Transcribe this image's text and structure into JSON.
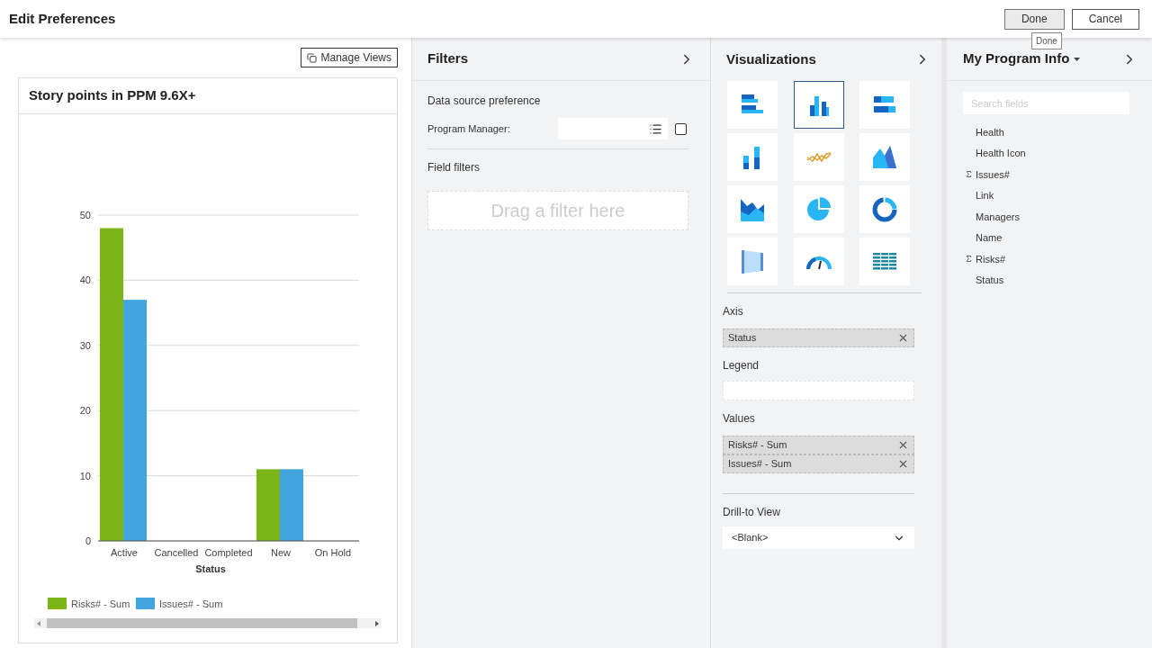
{
  "header": {
    "title": "Edit Preferences",
    "buttons": [
      {
        "label": "Done",
        "kind": "primary"
      },
      {
        "label": "Cancel",
        "kind": "secondary"
      }
    ],
    "tooltip": "Done"
  },
  "canvas": {
    "manage_views": "Manage Views",
    "card_title": "Story points in PPM 9.6X+",
    "chart_data": {
      "type": "bar",
      "xlabel": "Status",
      "categories": [
        "Active",
        "Cancelled",
        "Completed",
        "New",
        "On Hold"
      ],
      "series": [
        {
          "name": "Risks# - Sum",
          "color": "#7cb518",
          "values": [
            48,
            0,
            0,
            11,
            0
          ]
        },
        {
          "name": "Issues# - Sum",
          "color": "#42a5e0",
          "values": [
            37,
            0,
            0,
            11,
            0
          ]
        }
      ],
      "ylim": [
        0,
        50
      ],
      "yticks": [
        0,
        10,
        20,
        30,
        40,
        50
      ],
      "grid": true,
      "legend": true
    }
  },
  "filters": {
    "title": "Filters",
    "data_source": "Data source preference",
    "program_manager_label": "Program Manager:",
    "program_manager_checked": false,
    "field_filters": "Field filters",
    "drop_hint": "Drag a filter here"
  },
  "visualizations": {
    "title": "Visualizations",
    "types": [
      {
        "kind": "bar-h",
        "selected": false
      },
      {
        "kind": "column",
        "selected": true
      },
      {
        "kind": "stacked-bar-h",
        "selected": false
      },
      {
        "kind": "stacked-column",
        "selected": false
      },
      {
        "kind": "line",
        "selected": false
      },
      {
        "kind": "area",
        "selected": false
      },
      {
        "kind": "stacked-area",
        "selected": false
      },
      {
        "kind": "pie",
        "selected": false
      },
      {
        "kind": "donut",
        "selected": false
      },
      {
        "kind": "funnel",
        "selected": false
      },
      {
        "kind": "gauge",
        "selected": false
      },
      {
        "kind": "table",
        "selected": false
      }
    ],
    "axis_label": "Axis",
    "axis": [
      "Status"
    ],
    "legend_label": "Legend",
    "values_label": "Values",
    "values": [
      "Risks# - Sum",
      "Issues# - Sum"
    ],
    "drill_label": "Drill-to View",
    "drill_value": "<Blank>"
  },
  "fields": {
    "title": "My Program Info",
    "search_placeholder": "Search fields",
    "items": [
      {
        "name": "Health",
        "kind": "text"
      },
      {
        "name": "Health Icon",
        "kind": "text"
      },
      {
        "name": "Issues#",
        "kind": "sum"
      },
      {
        "name": "Link",
        "kind": "text"
      },
      {
        "name": "Managers",
        "kind": "text"
      },
      {
        "name": "Name",
        "kind": "text"
      },
      {
        "name": "Risks#",
        "kind": "sum"
      },
      {
        "name": "Status",
        "kind": "text"
      }
    ]
  }
}
